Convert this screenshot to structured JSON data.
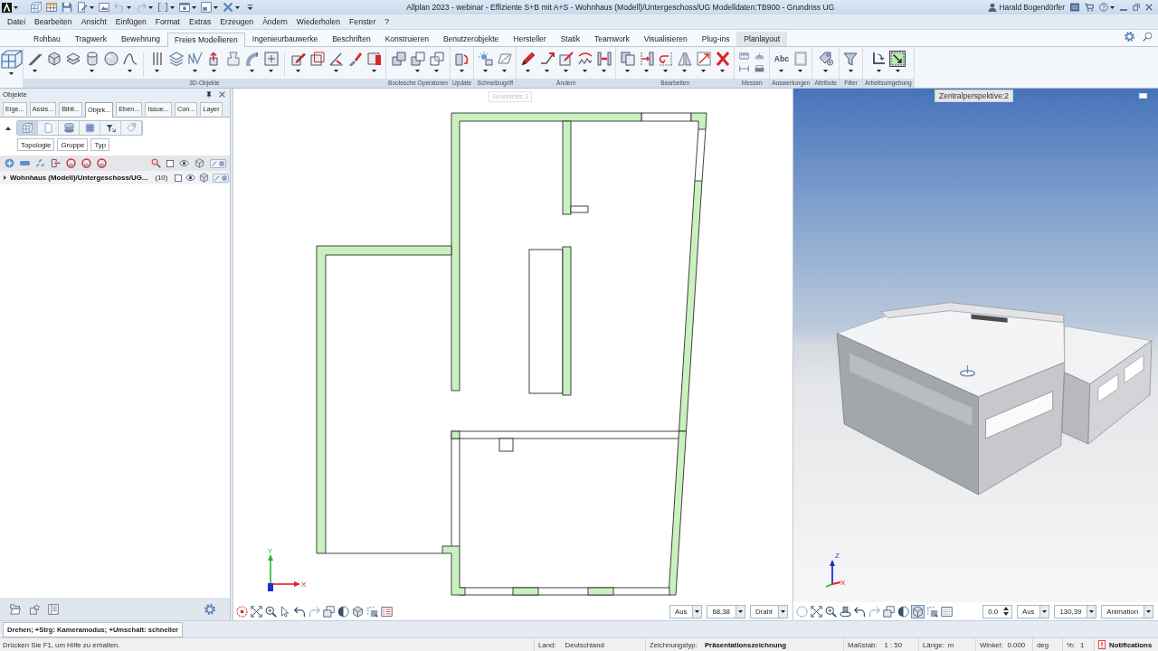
{
  "title_bar": {
    "quick_access": [
      {
        "kind": "frame3d",
        "dropdown": false,
        "disabled": false
      },
      {
        "kind": "table",
        "dropdown": false,
        "disabled": false
      },
      {
        "kind": "save",
        "dropdown": false,
        "disabled": false
      },
      {
        "kind": "editpage",
        "dropdown": true,
        "disabled": false
      },
      {
        "kind": "picture",
        "dropdown": false,
        "disabled": false
      },
      {
        "kind": "undo",
        "dropdown": true,
        "disabled": true
      },
      {
        "kind": "redo",
        "dropdown": true,
        "disabled": true
      },
      {
        "kind": "bracket",
        "dropdown": true,
        "disabled": false
      },
      {
        "kind": "window",
        "dropdown": true,
        "disabled": false
      },
      {
        "kind": "layout",
        "dropdown": true,
        "disabled": false
      },
      {
        "kind": "tools",
        "dropdown": true,
        "disabled": false
      },
      {
        "kind": "customize",
        "dropdown": false,
        "disabled": false
      }
    ],
    "title": "Allplan 2023 - webinar - Effiziente S+B mit A+S - Wohnhaus (Modell)/Untergeschoss/UG Modelldaten:TB900 - Grundriss UG",
    "user": "Harald Bogendörfer"
  },
  "menu": [
    "Datei",
    "Bearbeiten",
    "Ansicht",
    "Einfügen",
    "Format",
    "Extras",
    "Erzeugen",
    "Ändern",
    "Wiederholen",
    "Fenster",
    "?"
  ],
  "ribbon": {
    "tabs": [
      {
        "label": "Rohbau",
        "selected": false,
        "shaded": false
      },
      {
        "label": "Tragwerk",
        "selected": false,
        "shaded": false
      },
      {
        "label": "Bewehrung",
        "selected": false,
        "shaded": false
      },
      {
        "label": "Freies Modellieren",
        "selected": true,
        "shaded": false
      },
      {
        "label": "Ingenieurbauwerke",
        "selected": false,
        "shaded": false
      },
      {
        "label": "Beschriften",
        "selected": false,
        "shaded": false
      },
      {
        "label": "Konstruieren",
        "selected": false,
        "shaded": false
      },
      {
        "label": "Benutzerobjekte",
        "selected": false,
        "shaded": false
      },
      {
        "label": "Hersteller",
        "selected": false,
        "shaded": false
      },
      {
        "label": "Statik",
        "selected": false,
        "shaded": false
      },
      {
        "label": "Teamwork",
        "selected": false,
        "shaded": false
      },
      {
        "label": "Visualisieren",
        "selected": false,
        "shaded": false
      },
      {
        "label": "Plug-ins",
        "selected": false,
        "shaded": false
      },
      {
        "label": "Planlayout",
        "selected": false,
        "shaded": true
      }
    ],
    "groups": [
      {
        "tools": [
          {
            "kind": "frame3d",
            "dropdown": true,
            "on": false
          }
        ]
      },
      {
        "label": "3D-Objekte",
        "tools": [
          {
            "kind": "line",
            "dropdown": true,
            "on": false
          },
          {
            "kind": "box",
            "dropdown": false,
            "on": false
          },
          {
            "kind": "plane",
            "dropdown": false,
            "on": false
          },
          {
            "kind": "cylinder",
            "dropdown": true,
            "on": false
          },
          {
            "kind": "sphere",
            "dropdown": false,
            "on": false
          },
          {
            "kind": "curve",
            "dropdown": true,
            "on": false
          },
          {
            "kind": "separator"
          },
          {
            "kind": "bars",
            "dropdown": true,
            "on": false
          },
          {
            "kind": "layers",
            "dropdown": false,
            "on": false
          },
          {
            "kind": "wave",
            "dropdown": true,
            "on": false
          },
          {
            "kind": "extrude",
            "dropdown": true,
            "on": false
          },
          {
            "kind": "loft",
            "dropdown": false,
            "on": false
          },
          {
            "kind": "sweep",
            "dropdown": true,
            "on": false
          },
          {
            "kind": "frameplus",
            "dropdown": true,
            "on": false
          },
          {
            "kind": "separator"
          },
          {
            "kind": "pencilsq",
            "dropdown": true,
            "on": false
          },
          {
            "kind": "cubered",
            "dropdown": false,
            "on": false
          },
          {
            "kind": "angle",
            "dropdown": true,
            "on": false
          },
          {
            "kind": "brush",
            "dropdown": false,
            "on": false
          },
          {
            "kind": "cubeside",
            "dropdown": true,
            "on": false
          }
        ]
      },
      {
        "label": "Boolesche Operatoren",
        "tools": [
          {
            "kind": "union",
            "dropdown": false,
            "on": false
          },
          {
            "kind": "subtract",
            "dropdown": true,
            "on": false
          },
          {
            "kind": "intersect",
            "dropdown": true,
            "on": false
          }
        ]
      },
      {
        "label": "Update",
        "tools": [
          {
            "kind": "update",
            "dropdown": true,
            "on": false
          }
        ]
      },
      {
        "label": "Schnellzugriff",
        "tools": [
          {
            "kind": "sparkle",
            "dropdown": true,
            "on": false
          },
          {
            "kind": "parallelogram",
            "dropdown": true,
            "on": false
          }
        ]
      },
      {
        "label": "Ändern",
        "tools": [
          {
            "kind": "pencil",
            "dropdown": true,
            "on": false
          },
          {
            "kind": "linepick",
            "dropdown": true,
            "on": false
          },
          {
            "kind": "editsq",
            "dropdown": true,
            "on": false
          },
          {
            "kind": "zigzag",
            "dropdown": true,
            "on": false
          },
          {
            "kind": "colarrow",
            "dropdown": true,
            "on": false
          }
        ]
      },
      {
        "label": "Bearbeiten",
        "tools": [
          {
            "kind": "copy",
            "dropdown": true,
            "on": false
          },
          {
            "kind": "move",
            "dropdown": true,
            "on": false
          },
          {
            "kind": "rotate2",
            "dropdown": true,
            "on": false
          },
          {
            "kind": "mirror",
            "dropdown": true,
            "on": false
          },
          {
            "kind": "scale",
            "dropdown": true,
            "on": false
          },
          {
            "kind": "delete",
            "dropdown": true,
            "on": false
          }
        ]
      },
      {
        "label": "Messen",
        "tools": [
          {
            "kind": "ruler",
            "dropdown": false,
            "on": false
          },
          {
            "kind": "dimension",
            "dropdown": false,
            "on": false
          },
          {
            "kind": "stamp",
            "dropdown": false,
            "on": false
          },
          {
            "kind": "printer",
            "dropdown": false,
            "on": false
          }
        ]
      },
      {
        "label": "Auswertungen",
        "tools": [
          {
            "kind": "text",
            "label": "Abc",
            "dropdown": true,
            "on": false
          },
          {
            "kind": "page",
            "dropdown": true,
            "on": false
          }
        ]
      },
      {
        "label": "Attribute",
        "tools": [
          {
            "kind": "tags",
            "dropdown": true,
            "on": false
          }
        ]
      },
      {
        "label": "Filter",
        "tools": [
          {
            "kind": "funnel",
            "dropdown": true,
            "on": false
          }
        ]
      },
      {
        "label": "Arbeitsumgebung",
        "tools": [
          {
            "kind": "cornerarrow",
            "dropdown": true,
            "on": false
          },
          {
            "kind": "pointergrid",
            "dropdown": true,
            "on": true
          }
        ]
      }
    ]
  },
  "objects_panel": {
    "title": "Objekte",
    "tabs": [
      {
        "label": "Eige...",
        "selected": false
      },
      {
        "label": "Assis...",
        "selected": false
      },
      {
        "label": "Bibli...",
        "selected": false
      },
      {
        "label": "Objek...",
        "selected": true
      },
      {
        "label": "Eben...",
        "selected": false
      },
      {
        "label": "Issue...",
        "selected": false
      },
      {
        "label": "Con...",
        "selected": false
      },
      {
        "label": "Layer",
        "selected": false
      }
    ],
    "view_modes": [
      {
        "kind": "frame3d",
        "selected": true
      },
      {
        "kind": "doc",
        "selected": false
      },
      {
        "kind": "stack",
        "selected": false
      },
      {
        "kind": "grid",
        "selected": false
      },
      {
        "kind": "filterarrow",
        "selected": false
      },
      {
        "kind": "tag",
        "selected": false
      }
    ],
    "groupings": [
      "Topologie",
      "Gruppe",
      "Typ"
    ],
    "tree": [
      {
        "label": "Wohnhaus (Modell)/Untergeschoss/UG...",
        "count": "(10)",
        "expanded": false,
        "checked": false
      }
    ]
  },
  "views": [
    {
      "kind": "plan",
      "title": "Grundriss:1",
      "active": false,
      "axis_labels": [
        "Y",
        "X"
      ],
      "tools": [
        {
          "kind": "target",
          "selected": false,
          "disabled": false
        },
        {
          "kind": "fit",
          "selected": false,
          "disabled": false
        },
        {
          "kind": "zoom",
          "selected": false,
          "disabled": false
        },
        {
          "kind": "pointer",
          "selected": false,
          "disabled": false
        },
        {
          "kind": "undov",
          "selected": false,
          "disabled": false
        },
        {
          "kind": "redov",
          "selected": false,
          "disabled": true
        },
        {
          "kind": "vstack",
          "selected": false,
          "disabled": false
        },
        {
          "kind": "halfcircle",
          "selected": false,
          "disabled": false
        },
        {
          "kind": "box",
          "selected": false,
          "disabled": false
        },
        {
          "kind": "sparkv",
          "selected": false,
          "disabled": false
        },
        {
          "kind": "list",
          "selected": false,
          "disabled": false
        }
      ],
      "controls": [
        {
          "kind": "dropdown",
          "value": "Aus"
        },
        {
          "kind": "dropdown",
          "value": "68,38"
        },
        {
          "kind": "dropdown",
          "value": "Draht"
        }
      ]
    },
    {
      "kind": "perspective",
      "title": "Zentralperspektive:2",
      "active": true,
      "axis_labels": [
        "Z",
        "X"
      ],
      "tools": [
        {
          "kind": "dotcircle",
          "selected": false,
          "disabled": false
        },
        {
          "kind": "fit",
          "selected": false,
          "disabled": false
        },
        {
          "kind": "zoom",
          "selected": false,
          "disabled": false
        },
        {
          "kind": "orbit",
          "selected": false,
          "disabled": false
        },
        {
          "kind": "undov",
          "selected": false,
          "disabled": false
        },
        {
          "kind": "redov",
          "selected": false,
          "disabled": true
        },
        {
          "kind": "vstack",
          "selected": false,
          "disabled": false
        },
        {
          "kind": "halfcircle",
          "selected": false,
          "disabled": false
        },
        {
          "kind": "box",
          "selected": true,
          "disabled": false
        },
        {
          "kind": "sparkv",
          "selected": false,
          "disabled": false
        },
        {
          "kind": "dotlist",
          "selected": false,
          "disabled": false
        }
      ],
      "controls": [
        {
          "kind": "spinner",
          "value": "0.0"
        },
        {
          "kind": "dropdown",
          "value": "Aus"
        },
        {
          "kind": "dropdown",
          "value": "130,39"
        },
        {
          "kind": "dropdown",
          "value": "Animation"
        }
      ]
    }
  ],
  "hint": "Drehen; +Strg: Kameramodus; +Umschalt: schneller",
  "status_bar": {
    "help": "Drücken Sie F1, um Hilfe zu erhalten.",
    "fields": [
      {
        "label": "Land:",
        "value": "Deutschland",
        "emphasized": false
      },
      {
        "label": "Zeichnungstyp:",
        "value": "Präsentationszeichnung",
        "emphasized": true
      },
      {
        "label": "Maßstab:",
        "value": "1 : 50",
        "emphasized": false
      },
      {
        "label": "Länge:",
        "value": "m",
        "emphasized": false
      },
      {
        "label": "Winkel:",
        "value": "0.000",
        "emphasized": false
      },
      {
        "value": "deg",
        "emphasized": false
      },
      {
        "label": "%:",
        "value": "1",
        "emphasized": false
      }
    ],
    "notifications": "Notifications"
  }
}
